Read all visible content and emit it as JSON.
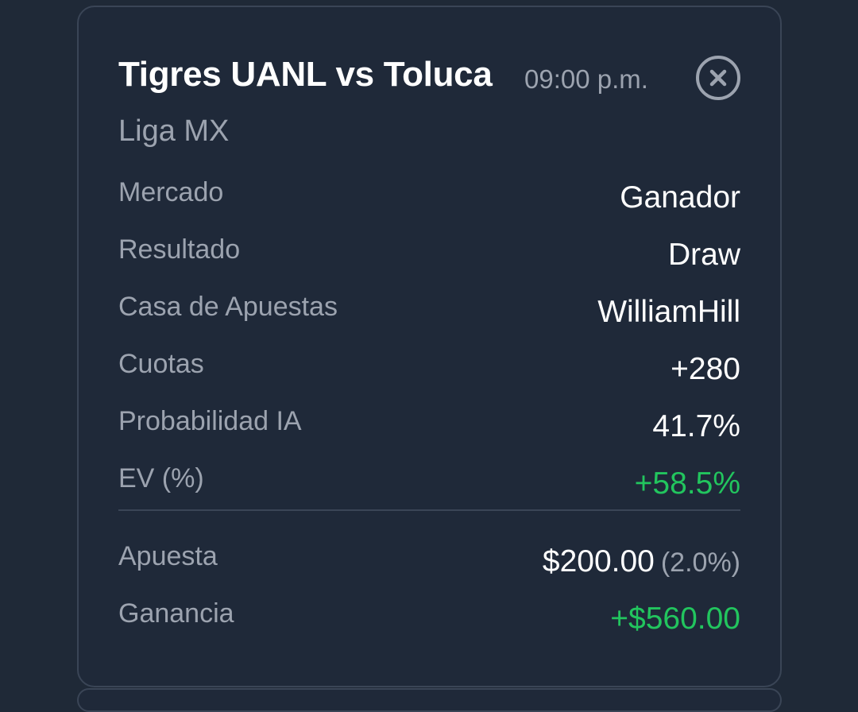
{
  "bet_card": {
    "title": "Tigres UANL vs Toluca",
    "time": "09:00 p.m.",
    "league": "Liga MX",
    "close_icon": "close-circle-icon",
    "details": [
      {
        "label": "Mercado",
        "value": "Ganador"
      },
      {
        "label": "Resultado",
        "value": "Draw"
      },
      {
        "label": "Casa de Apuestas",
        "value": "WilliamHill"
      },
      {
        "label": "Cuotas",
        "value": "+280"
      },
      {
        "label": "Probabilidad IA",
        "value": "41.7%"
      },
      {
        "label": "EV (%)",
        "value": "+58.5%"
      }
    ],
    "stake": {
      "label": "Apuesta",
      "amount": "$200.00",
      "percent": "(2.0%)"
    },
    "profit": {
      "label": "Ganancia",
      "amount": "+$560.00"
    }
  },
  "colors": {
    "background": "#1f2937",
    "card": "#1f2939",
    "border": "#3a4556",
    "muted_text": "#9ca3af",
    "positive": "#22c55e"
  }
}
